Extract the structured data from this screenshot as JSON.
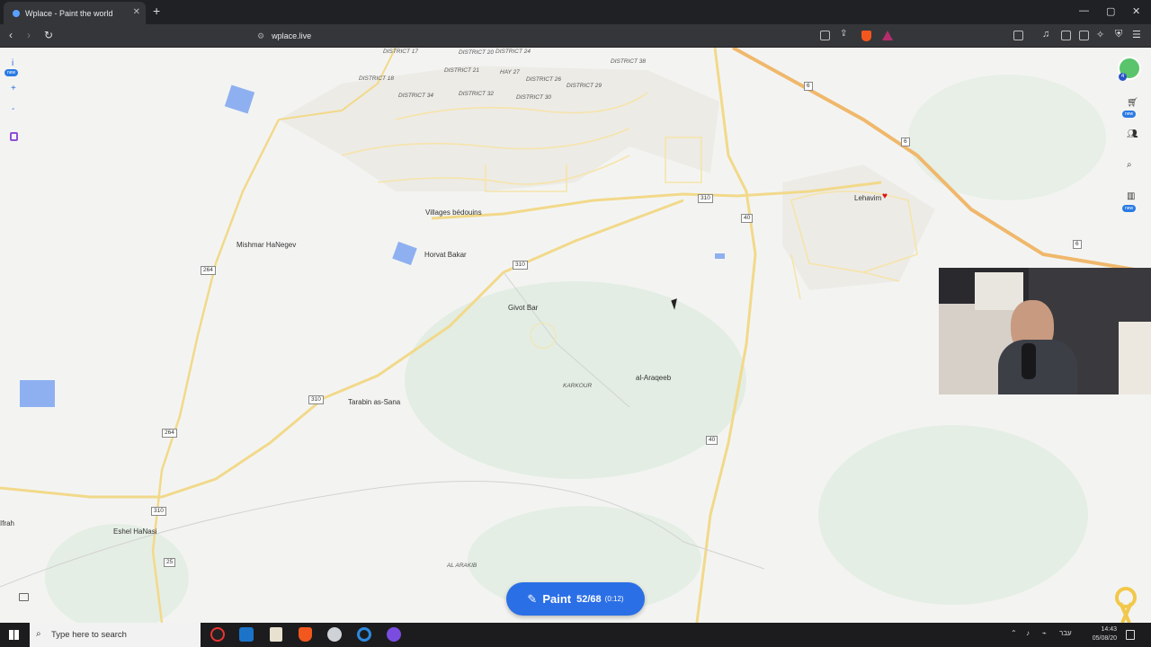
{
  "browser": {
    "tab_title": "Wplace - Paint the world",
    "url": "wplace.live"
  },
  "map": {
    "labels": {
      "d17": "DISTRICT 17",
      "d20": "DISTRICT 20",
      "d24": "DISTRICT 24",
      "d18": "DISTRICT 18",
      "d21": "DISTRICT 21",
      "hay27": "HAY 27",
      "d26": "DISTRICT 26",
      "d38": "DISTRICT 38",
      "d34": "DISTRICT 34",
      "d32": "DISTRICT 32",
      "d30": "DISTRICT 30",
      "d29": "DISTRICT 29",
      "villages": "Villages bédouins",
      "mishmar": "Mishmar HaNegev",
      "horvat": "Horvat Bakar",
      "givot": "Givot Bar",
      "lehavim": "Lehavim",
      "alaraqeeb": "al-Araqeeb",
      "karkour": "KARKOUR",
      "tarabin": "Tarabin as-Sana",
      "eshel": "Eshel HaNasi",
      "alarakib": "AL ARAKIB",
      "ifrah": "Ifrah"
    },
    "roads": [
      "6",
      "6",
      "6",
      "310",
      "40",
      "310",
      "264",
      "310",
      "264",
      "40",
      "310",
      "25"
    ]
  },
  "left_tools": {
    "info": "i",
    "new_badge": "new",
    "zoom_in": "+",
    "zoom_out": "-"
  },
  "right_tools": {
    "new_badge": "new",
    "user_badge": "4"
  },
  "paint": {
    "label": "Paint",
    "count": "52/68",
    "timer": "(0:12)"
  },
  "taskbar": {
    "search_placeholder": "Type here to search",
    "lang": "עבר",
    "time": "14:43",
    "date": "05/08/20"
  },
  "colors": {
    "accent": "#2b6fe6",
    "pixel_blue": "#8fb0f0",
    "road_yellow": "#f2d98a",
    "road_orange": "#f0b86c"
  }
}
